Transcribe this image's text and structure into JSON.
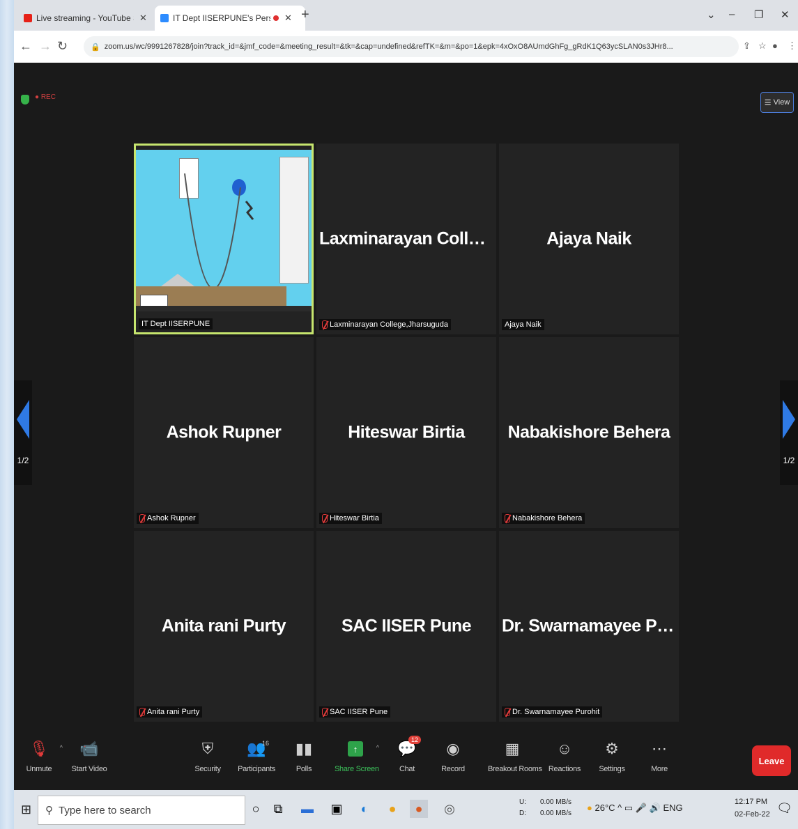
{
  "browser": {
    "tabs": [
      {
        "title": "Live streaming - YouTube Studio",
        "favicon_color": "#e62117"
      },
      {
        "title": "IT Dept IISERPUNE's Personal Meeting Room",
        "favicon_color": "#2d8cff"
      }
    ],
    "url": "zoom.us/wc/9991267828/join?track_id=&jmf_code=&meeting_result=&tk=&cap=undefined&refTK=&m=&po=1&epk=4xOxO8AUmdGhFg_gRdK1Q63ycSLAN0s3JHr8..."
  },
  "zoom": {
    "rec_label": "● REC",
    "view_label": "View",
    "page_indicator": "1/2",
    "participants": [
      {
        "display": "",
        "label": "IT Dept IISERPUNE",
        "active": true
      },
      {
        "display": "Laxminarayan College,Jhar...",
        "label": "Laxminarayan College,Jharsuguda"
      },
      {
        "display": "Ajaya Naik",
        "label": "Ajaya Naik"
      },
      {
        "display": "Ashok Rupner",
        "label": "Ashok Rupner"
      },
      {
        "display": "Hiteswar Birtia",
        "label": "Hiteswar Birtia"
      },
      {
        "display": "Nabakishore Behera",
        "label": "Nabakishore Behera"
      },
      {
        "display": "Anita rani Purty",
        "label": "Anita rani Purty"
      },
      {
        "display": "SAC IISER Pune",
        "label": "SAC IISER Pune"
      },
      {
        "display": "Dr. Swarnamayee Purohit",
        "label": "Dr. Swarnamayee Purohit"
      }
    ]
  },
  "toolbar": {
    "unmute": "Unmute",
    "start_video": "Start Video",
    "security": "Security",
    "participants": "Participants",
    "participants_count": "16",
    "polls": "Polls",
    "share_screen": "Share Screen",
    "chat": "Chat",
    "chat_badge": "12",
    "record": "Record",
    "breakout_rooms": "Breakout Rooms",
    "reactions": "Reactions",
    "settings": "Settings",
    "more": "More",
    "leave": "Leave"
  },
  "taskbar": {
    "search_placeholder": "Type here to search",
    "upload_label": "U:",
    "download_label": "D:",
    "upload_speed": "0.00 MB/s",
    "download_speed": "0.00 MB/s",
    "temperature": "26°C",
    "language": "ENG",
    "time": "12:17 PM",
    "date": "02-Feb-22"
  }
}
